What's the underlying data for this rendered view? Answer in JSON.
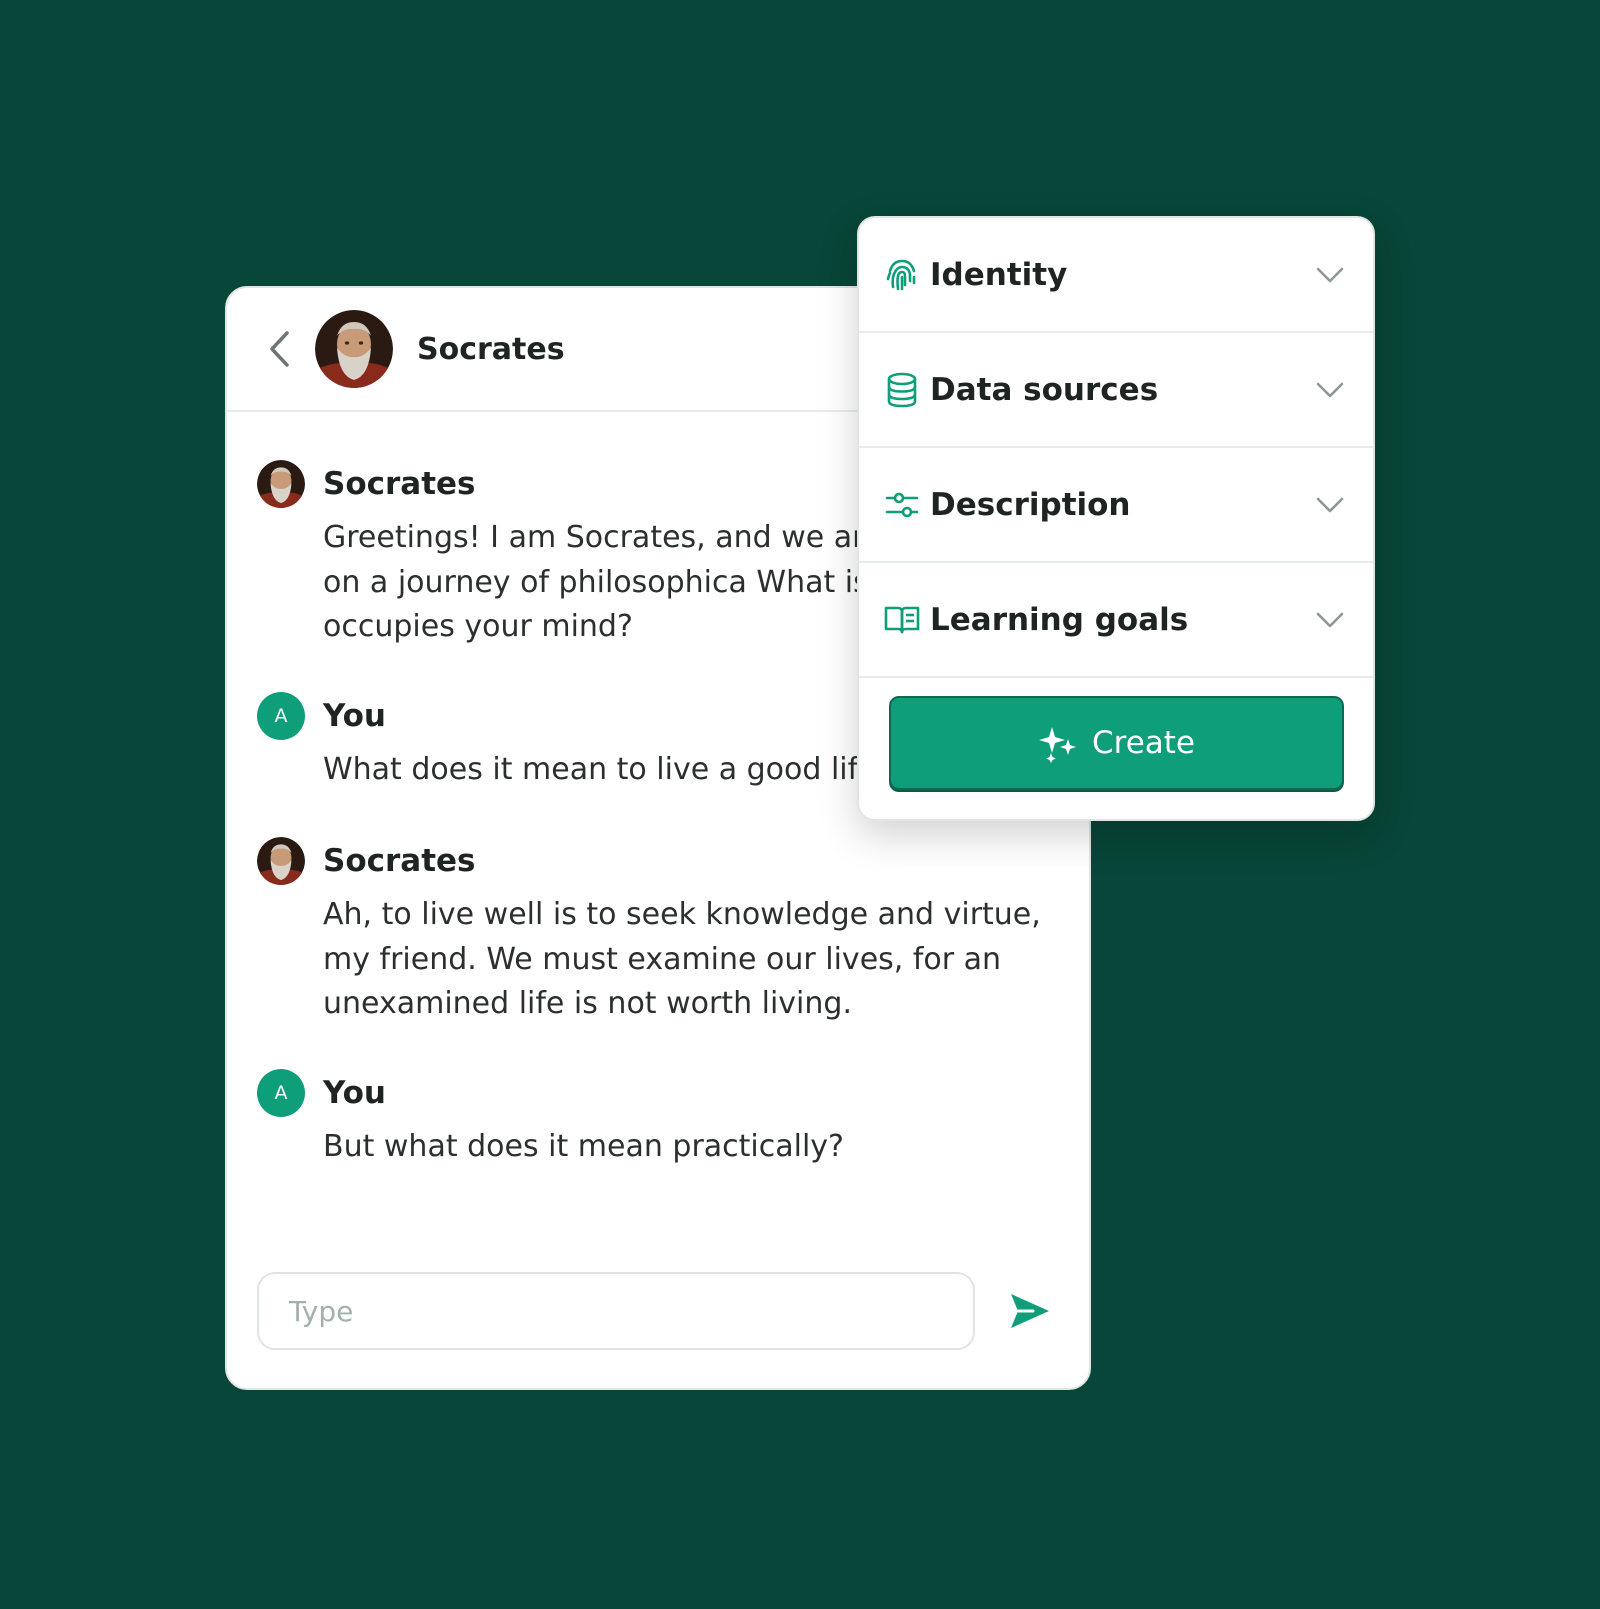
{
  "colors": {
    "background": "#074638",
    "accent": "#0e9e7a",
    "card": "#ffffff"
  },
  "chat": {
    "header": {
      "back_icon": "chevron-left-icon",
      "name": "Socrates"
    },
    "messages": [
      {
        "author": "Socrates",
        "avatar": "socrates-portrait",
        "text": "Greetings! I am Socrates, and we are embark on a journey of philosophica What is it that occupies your mind?"
      },
      {
        "author": "You",
        "avatar_letter": "A",
        "text": "What does it mean to live a good life"
      },
      {
        "author": "Socrates",
        "avatar": "socrates-portrait",
        "text": "Ah, to live well is to seek knowledge and virtue, my friend. We must examine our lives, for an unexamined life is not worth living."
      },
      {
        "author": "You",
        "avatar_letter": "A",
        "text": "But what does it mean practically?"
      }
    ],
    "composer": {
      "placeholder": "Type",
      "send_icon": "send-icon"
    }
  },
  "settings_panel": {
    "items": [
      {
        "label": "Identity",
        "icon": "fingerprint-icon"
      },
      {
        "label": "Data sources",
        "icon": "database-icon"
      },
      {
        "label": "Description",
        "icon": "sliders-icon"
      },
      {
        "label": "Learning goals",
        "icon": "book-icon"
      }
    ],
    "create_button": {
      "label": "Create",
      "icon": "sparkles-icon"
    }
  }
}
